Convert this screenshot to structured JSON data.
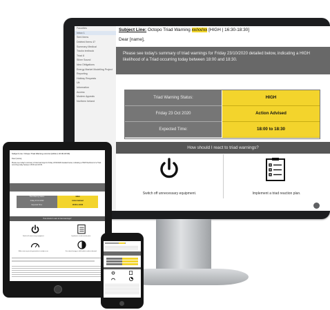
{
  "email": {
    "subject_prefix": "Subject Line:",
    "subject_middle": " Octopo Triad Warning ",
    "subject_date": "xx/xx/xx",
    "subject_suffix": " [HIGH | 16:30-18:30]",
    "greeting": "Dear [name],",
    "intro": "Please see today's summary of triad warnings for Friday 23/10/2020 detailed below, indicating a HIGH likelihood of a Triad occurring today between 18:00 and 18:30.",
    "table": [
      {
        "label": "Triad Warning Status:",
        "value": "HIGH"
      },
      {
        "label": "Friday 23 Oct 2020",
        "value": "Action Advised"
      },
      {
        "label": "Expected Time:",
        "value": "18:00 to 18:30"
      }
    ],
    "react_heading": "How should I react to triad warnings?",
    "react_items": [
      {
        "icon": "power-icon",
        "label": "Switch off unnecessary equipment."
      },
      {
        "icon": "checklist-icon",
        "label": "Implement a triad reaction plan."
      }
    ]
  },
  "sidebar": {
    "items": [
      "Favorites",
      "Inbox 1",
      "Sent Items",
      "Deleted Items 47",
      "Summary Medical",
      "Tracks textbook",
      "Triad 8",
      "Silver Sound",
      "Idea Obligations",
      "Energy Market Modelling Project",
      "Reporting",
      "Holiday Requests",
      "Uk",
      "Information",
      "Access",
      "Modern Appeals",
      "Northern Ireland"
    ]
  },
  "tablet": {
    "subject": "Subject Line: Octopo Triad Warning xx/xx/xx [HIGH | 16:30-18:30]",
    "greeting": "Dear [name],",
    "intro": "Please see today's summary of triad warnings for Friday 23/10/2020 detailed below, indicating a HIGH likelihood of a Triad occurring today between 18:00 and 18:30.",
    "react_heading": "How should I react to triad warnings?",
    "captions": [
      "Switch off unnecessary equipment.",
      "Implement a triad reaction plan.",
      "Make sure any on-site generation is ready to run.",
      "Use stored energy or shift loads to reduce demand."
    ]
  },
  "colors": {
    "accent_yellow": "#f3d42c",
    "banner_gray": "#686868",
    "bezel": "#1c1d1f"
  }
}
